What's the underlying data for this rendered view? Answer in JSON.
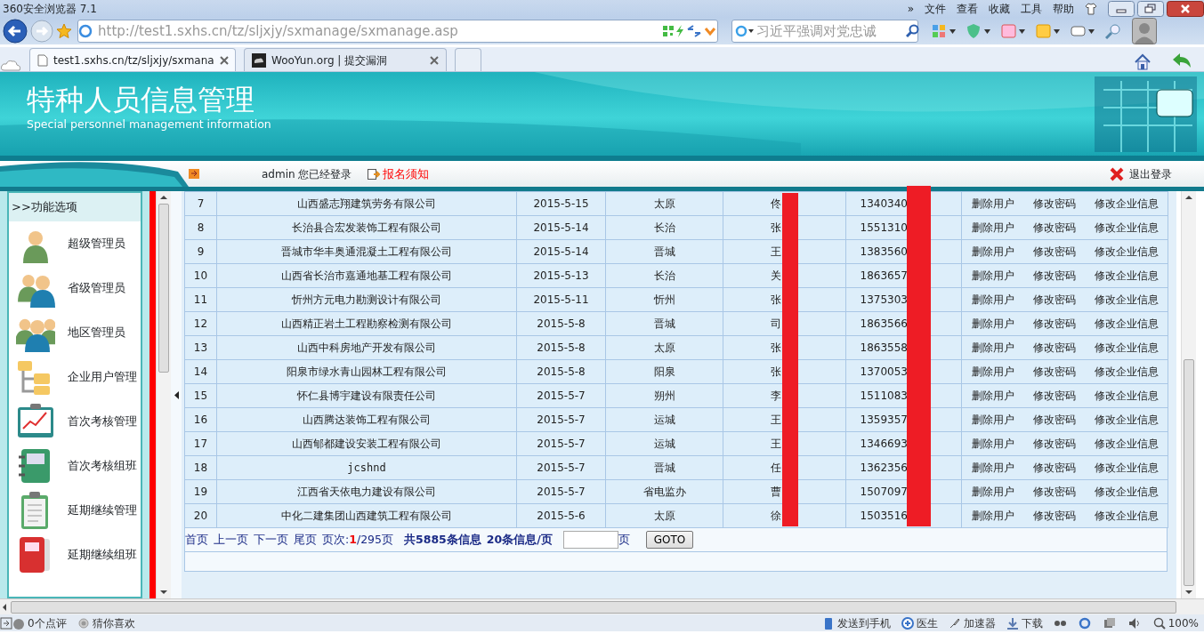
{
  "browser": {
    "title": "360安全浏览器 7.1",
    "more": "»",
    "menu": [
      "文件",
      "查看",
      "收藏",
      "工具",
      "帮助"
    ],
    "url": "http://test1.sxhs.cn/tz/sljxjy/sxmanage/sxmanage.asp",
    "search": {
      "placeholder": "习近平强调对党忠诚"
    },
    "tabs": [
      {
        "label": "test1.sxhs.cn/tz/sljxjy/sxmana",
        "selected": true
      },
      {
        "label": "WooYun.org | 提交漏洞",
        "selected": false
      }
    ]
  },
  "header": {
    "title": "特种人员信息管理",
    "subtitle": "Special personnel management information"
  },
  "login_bar": {
    "user": "admin",
    "status": "您已经登录",
    "notice": "报名须知",
    "logout": "退出登录"
  },
  "sidebar": {
    "heading": ">>功能选项",
    "items": [
      {
        "label": "超级管理员",
        "kind": "person"
      },
      {
        "label": "省级管理员",
        "kind": "pair"
      },
      {
        "label": "地区管理员",
        "kind": "group"
      },
      {
        "label": "企业用户管理",
        "kind": "folders"
      },
      {
        "label": "首次考核管理",
        "kind": "chart"
      },
      {
        "label": "首次考核组班",
        "kind": "notebook"
      },
      {
        "label": "延期继续管理",
        "kind": "clipboard"
      },
      {
        "label": "延期继续组班",
        "kind": "redbook"
      }
    ]
  },
  "table": {
    "rows": [
      {
        "cells": [
          "7",
          "山西盛志翔建筑劳务有限公司",
          "2015-5-15",
          "太原",
          "佟",
          "1340340"
        ],
        "actions": [
          "删除用户",
          "修改密码",
          "修改企业信息"
        ]
      },
      {
        "cells": [
          "8",
          "长治县合宏发装饰工程有限公司",
          "2015-5-14",
          "长治",
          "张",
          "1551310"
        ],
        "actions": [
          "删除用户",
          "修改密码",
          "修改企业信息"
        ]
      },
      {
        "cells": [
          "9",
          "晋城市华丰奥通混凝土工程有限公司",
          "2015-5-14",
          "晋城",
          "王",
          "1383560"
        ],
        "actions": [
          "删除用户",
          "修改密码",
          "修改企业信息"
        ]
      },
      {
        "cells": [
          "10",
          "山西省长治市嘉通地基工程有限公司",
          "2015-5-13",
          "长治",
          "关",
          "1863657"
        ],
        "actions": [
          "删除用户",
          "修改密码",
          "修改企业信息"
        ]
      },
      {
        "cells": [
          "11",
          "忻州方元电力勘测设计有限公司",
          "2015-5-11",
          "忻州",
          "张",
          "1375303"
        ],
        "actions": [
          "删除用户",
          "修改密码",
          "修改企业信息"
        ]
      },
      {
        "cells": [
          "12",
          "山西精正岩土工程勘察检测有限公司",
          "2015-5-8",
          "晋城",
          "司",
          "1863566"
        ],
        "actions": [
          "删除用户",
          "修改密码",
          "修改企业信息"
        ]
      },
      {
        "cells": [
          "13",
          "山西中科房地产开发有限公司",
          "2015-5-8",
          "太原",
          "张",
          "1863558"
        ],
        "actions": [
          "删除用户",
          "修改密码",
          "修改企业信息"
        ]
      },
      {
        "cells": [
          "14",
          "阳泉市绿水青山园林工程有限公司",
          "2015-5-8",
          "阳泉",
          "张",
          "1370053"
        ],
        "actions": [
          "删除用户",
          "修改密码",
          "修改企业信息"
        ]
      },
      {
        "cells": [
          "15",
          "怀仁县博宇建设有限责任公司",
          "2015-5-7",
          "朔州",
          "李",
          "1511083"
        ],
        "actions": [
          "删除用户",
          "修改密码",
          "修改企业信息"
        ]
      },
      {
        "cells": [
          "16",
          "山西腾达装饰工程有限公司",
          "2015-5-7",
          "运城",
          "王",
          "1359357"
        ],
        "actions": [
          "删除用户",
          "修改密码",
          "修改企业信息"
        ]
      },
      {
        "cells": [
          "17",
          "山西郇都建设安装工程有限公司",
          "2015-5-7",
          "运城",
          "王",
          "1346693"
        ],
        "actions": [
          "删除用户",
          "修改密码",
          "修改企业信息"
        ]
      },
      {
        "cells": [
          "18",
          "jcshnd",
          "2015-5-7",
          "晋城",
          "任",
          "1362356"
        ],
        "actions": [
          "删除用户",
          "修改密码",
          "修改企业信息"
        ]
      },
      {
        "cells": [
          "19",
          "江西省天依电力建设有限公司",
          "2015-5-7",
          "省电监办",
          "曹",
          "1507097"
        ],
        "actions": [
          "删除用户",
          "修改密码",
          "修改企业信息"
        ]
      },
      {
        "cells": [
          "20",
          "中化二建集团山西建筑工程有限公司",
          "2015-5-6",
          "太原",
          "徐",
          "1503516"
        ],
        "actions": [
          "删除用户",
          "修改密码",
          "修改企业信息"
        ]
      }
    ]
  },
  "pager": {
    "links": [
      "首页",
      "上一页",
      "下一页",
      "尾页"
    ],
    "page_label": "页次:",
    "page": "1",
    "page_total": "/295页",
    "total": "共5885条信息",
    "per_page": "20条信息/页",
    "goto_suffix": "页",
    "goto_button": "GOTO"
  },
  "status_bar": {
    "left": [
      "0个点评",
      "猜你喜欢"
    ],
    "right": [
      "发送到手机",
      "医生",
      "加速器",
      "下载"
    ],
    "zoom": "100%"
  }
}
